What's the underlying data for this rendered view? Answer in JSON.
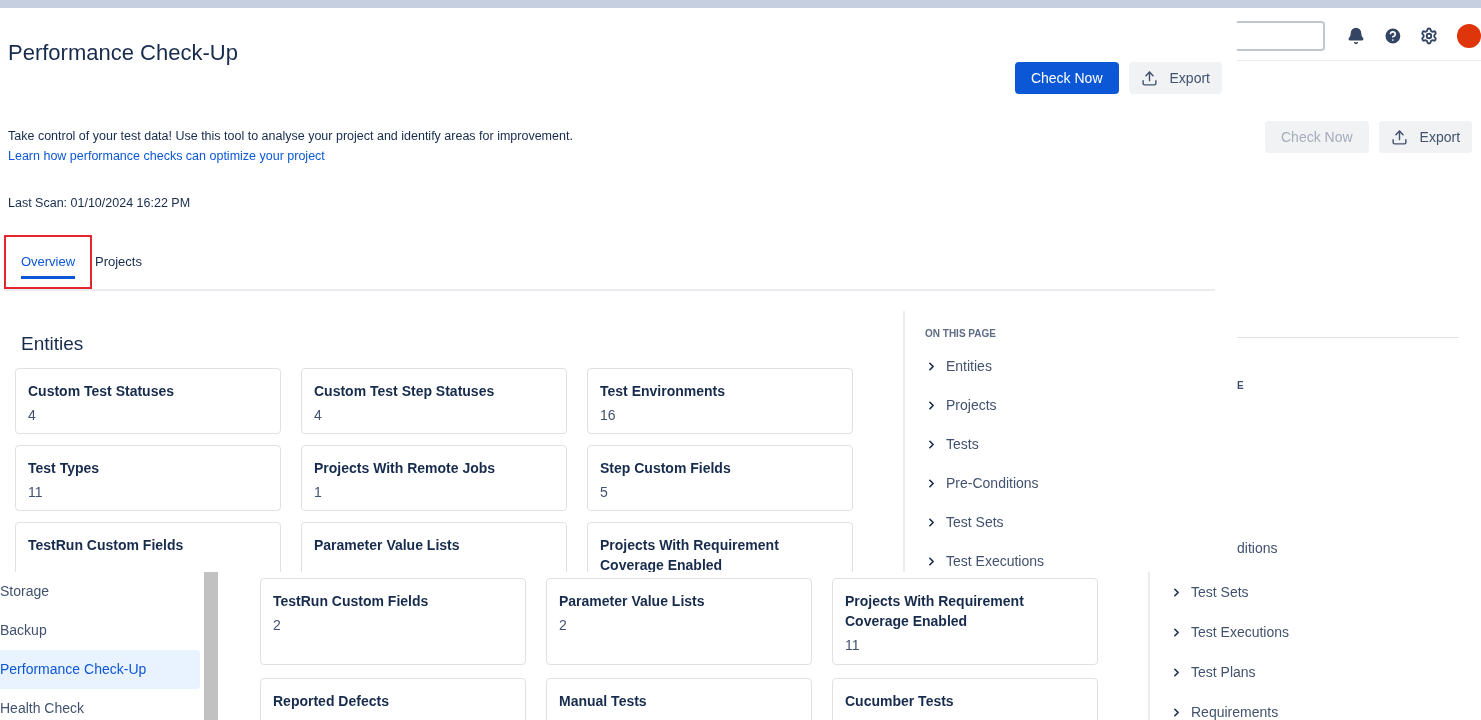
{
  "background_screen": {
    "check_now": {
      "label": "Check Now",
      "disabled": true
    },
    "export": {
      "label": "Export"
    },
    "fragments": [
      "E",
      "ditions"
    ]
  },
  "main_screen": {
    "title": "Performance Check-Up",
    "check_now": {
      "label": "Check Now",
      "disabled": false
    },
    "export": {
      "label": "Export"
    },
    "description": "Take control of your test data! Use this tool to analyse your project and identify areas for improvement.",
    "link": "Learn how performance checks can optimize your project",
    "last_scan": "Last Scan: 01/10/2024 16:22 PM",
    "tabs": [
      {
        "label": "Overview",
        "selected": true,
        "highlighted": true
      },
      {
        "label": "Projects",
        "selected": false,
        "highlighted": false
      }
    ],
    "section_title": "Entities",
    "cards": [
      {
        "title": "Custom Test Statuses",
        "value": "4"
      },
      {
        "title": "Custom Test Step Statuses",
        "value": "4"
      },
      {
        "title": "Test Environments",
        "value": "16"
      },
      {
        "title": "Test Types",
        "value": "11"
      },
      {
        "title": "Projects With Remote Jobs",
        "value": "1"
      },
      {
        "title": "Step Custom Fields",
        "value": "5"
      },
      {
        "title": "TestRun Custom Fields"
      },
      {
        "title": "Parameter Value Lists"
      },
      {
        "title": "Projects With Requirement Coverage Enabled"
      }
    ],
    "on_this_page": {
      "heading": "ON THIS PAGE",
      "items": [
        "Entities",
        "Projects",
        "Tests",
        "Pre-Conditions",
        "Test Sets",
        "Test Executions"
      ]
    }
  },
  "front_screen": {
    "sidebar": [
      {
        "label": "Storage",
        "selected": false
      },
      {
        "label": "Backup",
        "selected": false
      },
      {
        "label": "Performance Check-Up",
        "selected": true
      },
      {
        "label": "Health Check",
        "selected": false
      }
    ],
    "cards": [
      {
        "title": "TestRun Custom Fields",
        "value": "2"
      },
      {
        "title": "Parameter Value Lists",
        "value": "2"
      },
      {
        "title": "Projects With Requirement Coverage Enabled",
        "value": "11"
      },
      {
        "title": "Reported Defects"
      },
      {
        "title": "Manual Tests"
      },
      {
        "title": "Cucumber Tests"
      }
    ],
    "nav_items": [
      "Test Sets",
      "Test Executions",
      "Test Plans",
      "Requirements"
    ]
  }
}
